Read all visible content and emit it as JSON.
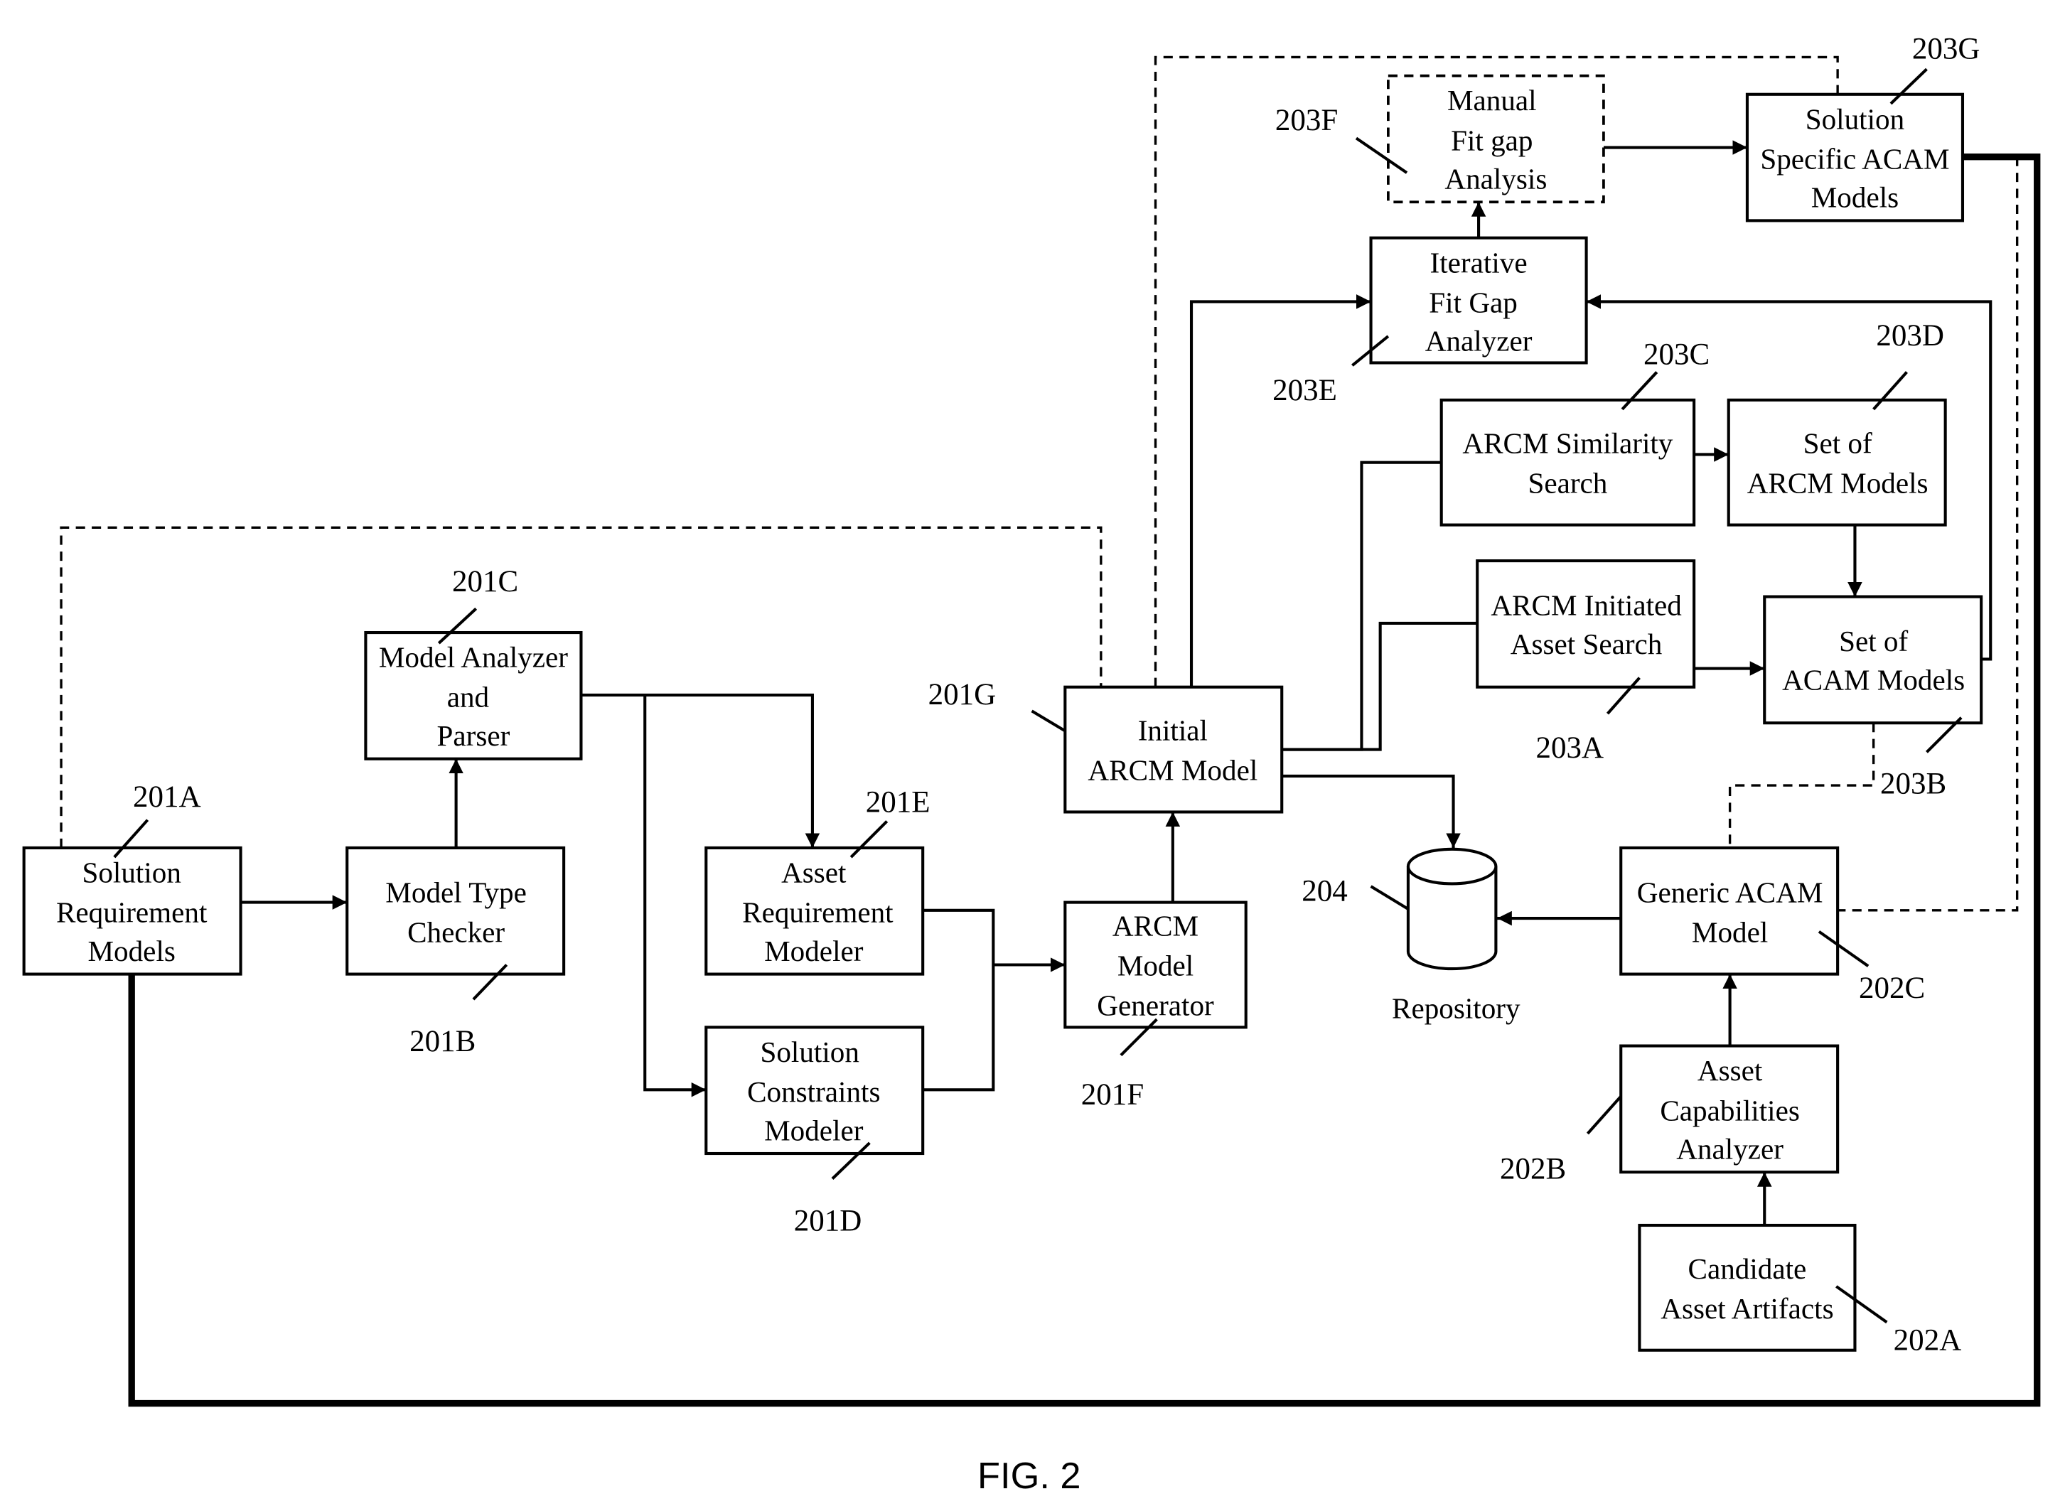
{
  "figure": {
    "caption": "FIG. 2",
    "colors": {
      "ink": "#000000",
      "background": "#ffffff"
    }
  },
  "nodes": {
    "n201A": {
      "ref": "201A",
      "lines": [
        "Solution",
        "Requirement",
        "Models"
      ]
    },
    "n201B": {
      "ref": "201B",
      "lines": [
        "Model Type",
        "Checker"
      ]
    },
    "n201C": {
      "ref": "201C",
      "lines": [
        "Model Analyzer",
        "and",
        "Parser"
      ]
    },
    "n201D": {
      "ref": "201D",
      "lines": [
        "Solution",
        "Constraints",
        "Modeler"
      ]
    },
    "n201E": {
      "ref": "201E",
      "lines": [
        "Asset",
        "Requirement",
        "Modeler"
      ]
    },
    "n201F": {
      "ref": "201F",
      "lines": [
        "ARCM",
        "Model",
        "Generator"
      ]
    },
    "n201G": {
      "ref": "201G",
      "lines": [
        "Initial",
        "ARCM Model"
      ]
    },
    "n202A": {
      "ref": "202A",
      "lines": [
        "Candidate",
        "Asset Artifacts"
      ]
    },
    "n202B": {
      "ref": "202B",
      "lines": [
        "Asset",
        "Capabilities",
        "Analyzer"
      ]
    },
    "n202C": {
      "ref": "202C",
      "lines": [
        "Generic  ACAM",
        "Model"
      ]
    },
    "n203A": {
      "ref": "203A",
      "lines": [
        "ARCM Initiated",
        "Asset Search"
      ]
    },
    "n203B": {
      "ref": "203B",
      "lines": [
        "Set of",
        "ACAM Models"
      ]
    },
    "n203C": {
      "ref": "203C",
      "lines": [
        "ARCM Similarity",
        "Search"
      ]
    },
    "n203D": {
      "ref": "203D",
      "lines": [
        "Set of",
        "ARCM Models"
      ]
    },
    "n203E": {
      "ref": "203E",
      "lines": [
        "Iterative",
        "Fit Gap",
        "Analyzer"
      ]
    },
    "n203F": {
      "ref": "203F",
      "lines": [
        "Manual",
        "Fit gap",
        "Analysis"
      ],
      "style": "dashed"
    },
    "n203G": {
      "ref": "203G",
      "lines": [
        "Solution",
        "Specific  ACAM",
        "Models"
      ]
    },
    "n204": {
      "ref": "204",
      "lines": [
        "Repository"
      ],
      "shape": "cylinder"
    }
  },
  "edges": [
    {
      "from": "201A",
      "to": "201B",
      "type": "arrow"
    },
    {
      "from": "201B",
      "to": "201C",
      "type": "arrow"
    },
    {
      "from": "201C",
      "to": "201E",
      "type": "arrow"
    },
    {
      "from": "201C",
      "to": "201D",
      "type": "arrow"
    },
    {
      "from": "201E",
      "to": "201F",
      "type": "arrow"
    },
    {
      "from": "201D",
      "to": "201F",
      "type": "arrow"
    },
    {
      "from": "201F",
      "to": "201G",
      "type": "arrow"
    },
    {
      "from": "201G",
      "to": "203E",
      "type": "arrow"
    },
    {
      "from": "201G",
      "to": "203C",
      "type": "line"
    },
    {
      "from": "201G",
      "to": "203A",
      "type": "line"
    },
    {
      "from": "201G",
      "to": "204",
      "type": "arrow"
    },
    {
      "from": "203C",
      "to": "203D",
      "type": "arrow"
    },
    {
      "from": "203D",
      "to": "203B",
      "type": "arrow"
    },
    {
      "from": "203A",
      "to": "203B",
      "type": "arrow"
    },
    {
      "from": "203B",
      "to": "203E",
      "type": "arrow"
    },
    {
      "from": "203E",
      "to": "203F",
      "type": "arrow"
    },
    {
      "from": "203F",
      "to": "203G",
      "type": "arrow"
    },
    {
      "from": "202A",
      "to": "202B",
      "type": "arrow"
    },
    {
      "from": "202B",
      "to": "202C",
      "type": "arrow"
    },
    {
      "from": "202C",
      "to": "204",
      "type": "arrow"
    },
    {
      "from": "201A",
      "to": "201G",
      "type": "dashed"
    },
    {
      "from": "201G",
      "to": "203G",
      "type": "dashed"
    },
    {
      "from": "203B",
      "to": "202C",
      "type": "dashed"
    },
    {
      "from": "203G",
      "to": "202C",
      "type": "dashed"
    },
    {
      "from": "203G",
      "to": "201A",
      "type": "thick"
    }
  ]
}
